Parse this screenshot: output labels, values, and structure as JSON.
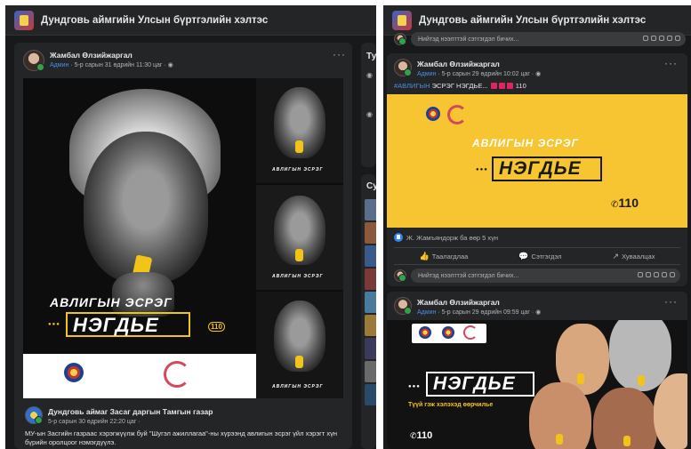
{
  "group_title": "Дундговь аймгийн Улсын бүртгэлийн хэлтэс",
  "left": {
    "author": "Жамбал Өлзийжаргал",
    "role": "Админ",
    "time": "· 5-р сарын 31 өдрийн 11:30 цаг ·",
    "more": "···",
    "slogan": "АВЛИГЫН ЭСРЭГ",
    "slogan_small": "АВЛИГЫН ЭСРЭГ",
    "brand": "НЭГДЬЕ",
    "dots_brand": "●●●",
    "hotline": "110",
    "shared_author": "Дундговь аймаг Засаг даргын Тамгын газар",
    "shared_time": "5-р сарын 30 өдрийн 22:20 цаг ·",
    "caption": "МУ-ын Засгийн газраас хэрэгжүүлж буй \"Шугэл ажиллагаа\"-ны хүрээнд авлигын эсрэг үйл хэрэгт хүн бүрийн оролцоог нэмэгдүүлэ.",
    "side_title_1": "Тух",
    "side_title_2": "Сун"
  },
  "right": {
    "comment_placeholder_top": "Нийтэд нээлттэй сэтгэгдэл бичих...",
    "post1": {
      "author": "Жамбал Өлзийжаргал",
      "role": "Админ",
      "time": "· 5-р сарын 29 өдрийн 10:02 цаг ·",
      "more": "···",
      "hashtag": "#АВЛИГЫН",
      "text_rest": "ЭСРЭГ НЭГДЬЕ...",
      "text_num": "110",
      "slogan": "АВЛИГЫН ЭСРЭГ",
      "brand": "НЭГДЬЕ",
      "dots_brand": "●●●",
      "hotline": "110",
      "reactions": "Ж. Жамъяндорж ба өөр 5 хүн",
      "like": "Таалагдлаа",
      "comment": "Сэтгэгдэл",
      "share": "Хуваалцах",
      "comment_placeholder": "Нийтэд нээлттэй сэтгэгдэл бичих..."
    },
    "post2": {
      "author": "Жамбал Өлзийжаргал",
      "role": "Админ",
      "time": "· 5-р сарын 29 өдрийн 09:59 цаг ·",
      "more": "···",
      "brand": "НЭГДЬЕ",
      "dots_brand": "●●●",
      "tagline": "Түүй гэж хэлэхэд өөрчилье",
      "hotline": "110"
    }
  },
  "colors": {
    "accent_yellow": "#f2c318",
    "link_blue": "#4a8fe7",
    "bg_dark": "#18191a",
    "card": "#242526"
  }
}
